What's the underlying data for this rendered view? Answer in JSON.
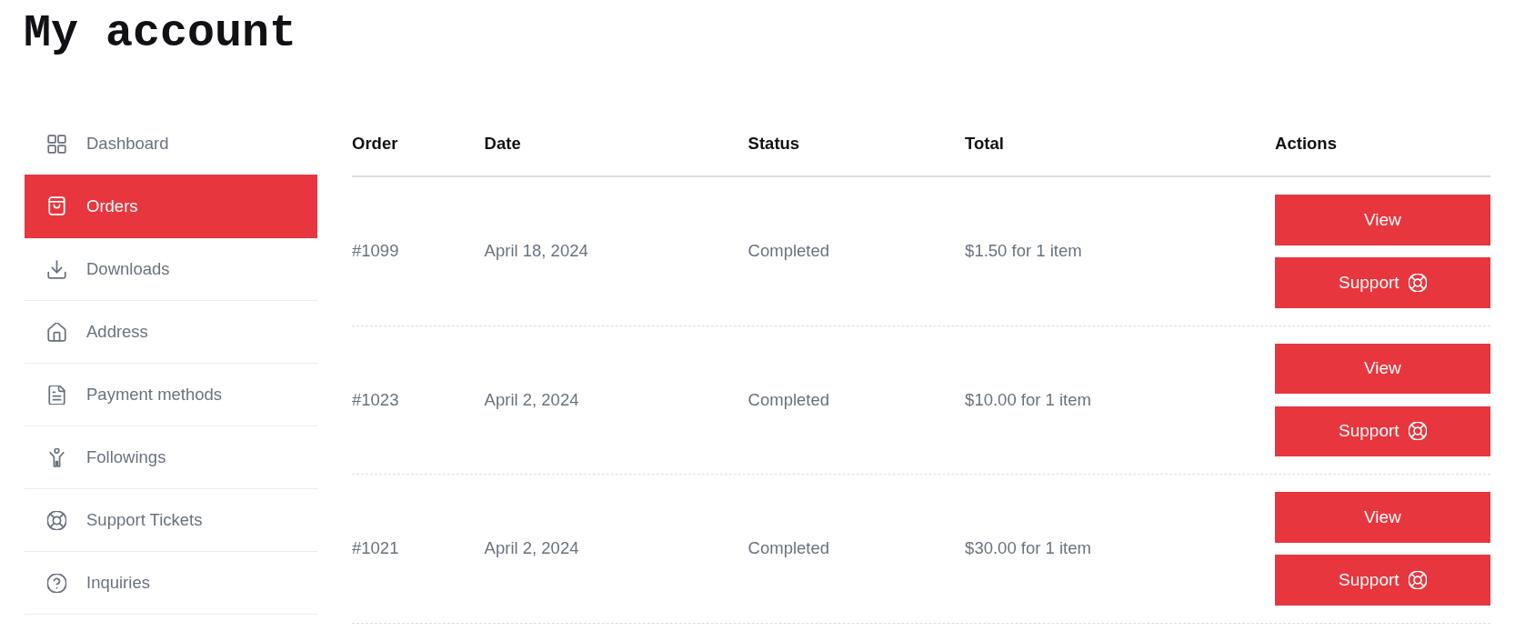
{
  "page": {
    "title": "My account"
  },
  "sidebar": {
    "items": [
      {
        "label": "Dashboard",
        "selected": false
      },
      {
        "label": "Orders",
        "selected": true
      },
      {
        "label": "Downloads",
        "selected": false
      },
      {
        "label": "Address",
        "selected": false
      },
      {
        "label": "Payment methods",
        "selected": false
      },
      {
        "label": "Followings",
        "selected": false
      },
      {
        "label": "Support Tickets",
        "selected": false
      },
      {
        "label": "Inquiries",
        "selected": false
      }
    ]
  },
  "orders_table": {
    "columns": [
      "Order",
      "Date",
      "Status",
      "Total",
      "Actions"
    ],
    "rows": [
      {
        "order": "#1099",
        "date": "April 18, 2024",
        "status": "Completed",
        "total": "$1.50 for 1 item",
        "actions": [
          {
            "kind": "plain",
            "label": "View"
          },
          {
            "kind": "icon",
            "label": "Support"
          }
        ]
      },
      {
        "order": "#1023",
        "date": "April 2, 2024",
        "status": "Completed",
        "total": "$10.00 for 1 item",
        "actions": [
          {
            "kind": "plain",
            "label": "View"
          },
          {
            "kind": "icon",
            "label": "Support"
          }
        ]
      },
      {
        "order": "#1021",
        "date": "April 2, 2024",
        "status": "Completed",
        "total": "$30.00 for 1 item",
        "actions": [
          {
            "kind": "plain",
            "label": "View"
          },
          {
            "kind": "icon",
            "label": "Support"
          }
        ]
      }
    ]
  }
}
